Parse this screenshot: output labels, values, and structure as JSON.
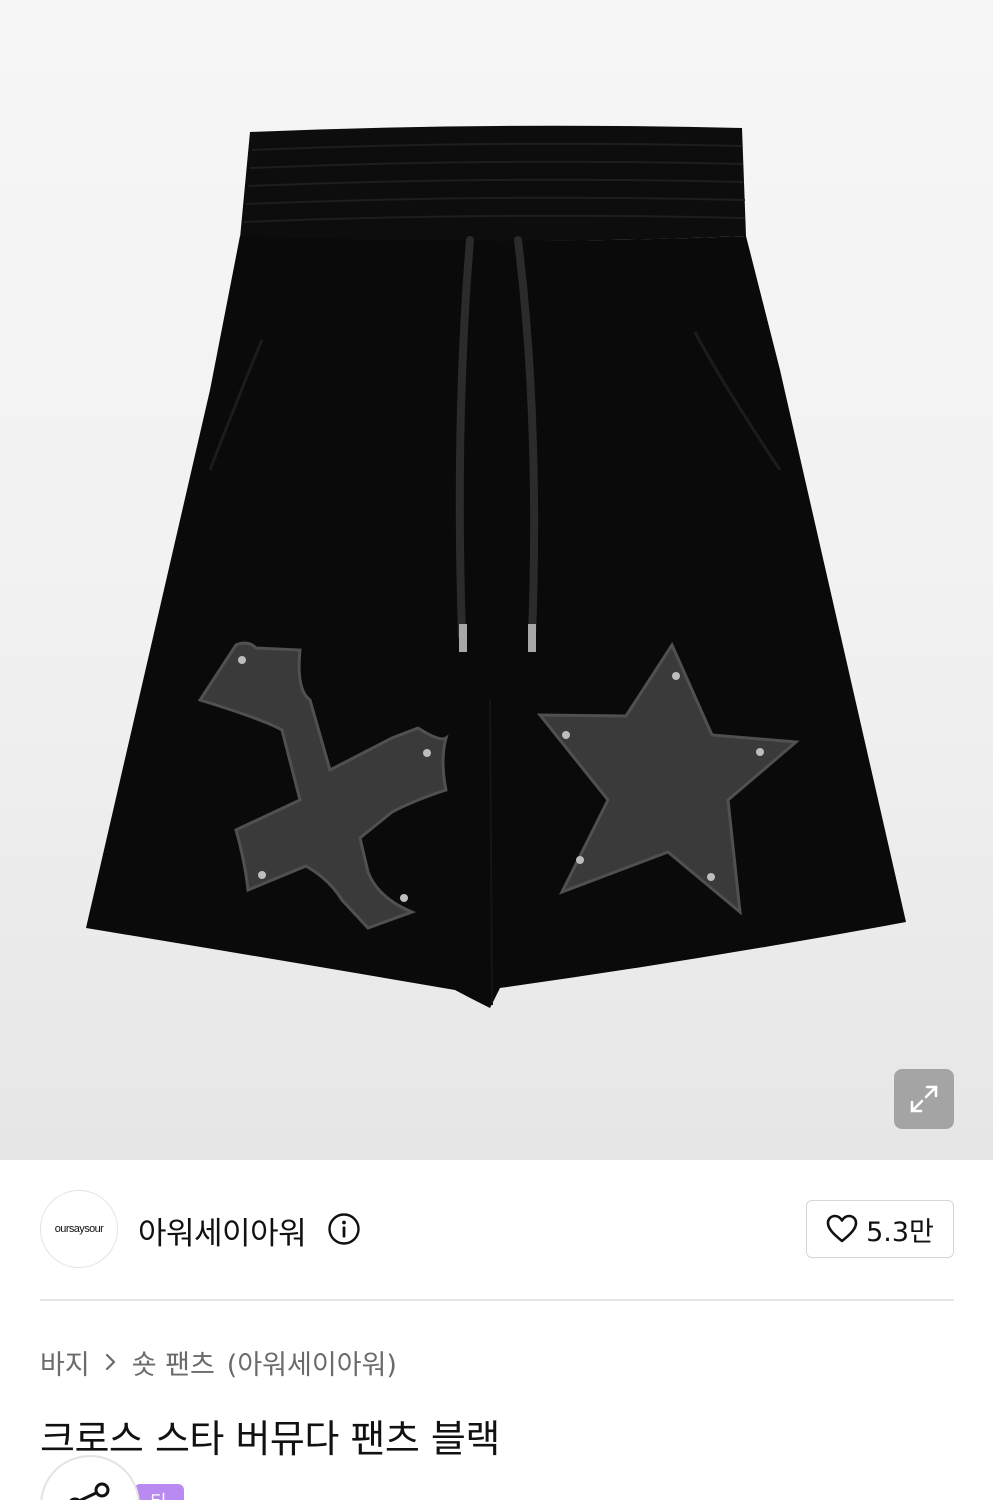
{
  "hero": {
    "image_alt": "black bermuda shorts with cross and star patches",
    "expand_icon": "expand-icon"
  },
  "brand": {
    "logo_text": "oursaysour",
    "name": "아워세이아워",
    "info_icon": "info-icon",
    "like_icon": "heart-icon",
    "like_count": "5.3만"
  },
  "breadcrumb": {
    "category": "바지",
    "chevron_icon": "chevron-right-icon",
    "subcategory": "숏 팬츠",
    "brand_suffix": "(아워세이아워)"
  },
  "product": {
    "title": "크로스 스타 버뮤다 팬츠 블랙"
  },
  "bottom": {
    "share_icon": "share-icon",
    "tag_text": "티"
  },
  "colors": {
    "accent_purple": "#b98bf2",
    "shorts_black": "#0a0a0a",
    "patch_gray": "#3a3a3a"
  }
}
